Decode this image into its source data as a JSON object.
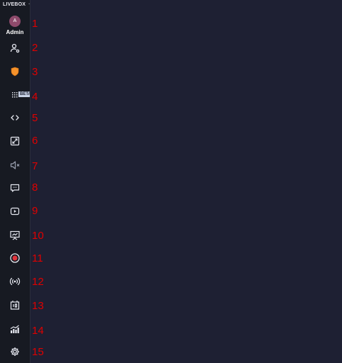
{
  "app": {
    "brand": "LIVEBOX",
    "brand_suffix": "··"
  },
  "user": {
    "initial": "A",
    "name": "Admin",
    "avatar_color": "#8e4a6b"
  },
  "sidebar": {
    "beta_badge": "BETA",
    "items": [
      {
        "icon": "user-settings-icon"
      },
      {
        "icon": "shield-icon",
        "color": "#f5922b"
      },
      {
        "icon": "apps-grid-icon"
      },
      {
        "icon": "code-icon"
      },
      {
        "icon": "fullscreen-icon"
      },
      {
        "icon": "speaker-muted-icon"
      },
      {
        "icon": "chat-icon"
      },
      {
        "icon": "youtube-icon"
      },
      {
        "icon": "presentation-icon"
      },
      {
        "icon": "record-icon",
        "color": "#e0343c"
      },
      {
        "icon": "broadcast-icon"
      },
      {
        "icon": "timer-icon"
      },
      {
        "icon": "analytics-icon"
      },
      {
        "icon": "settings-gear-icon"
      }
    ]
  },
  "annotations": [
    "1",
    "2",
    "3",
    "4",
    "5",
    "6",
    "7",
    "8",
    "9",
    "10",
    "11",
    "12",
    "13",
    "14",
    "15"
  ]
}
